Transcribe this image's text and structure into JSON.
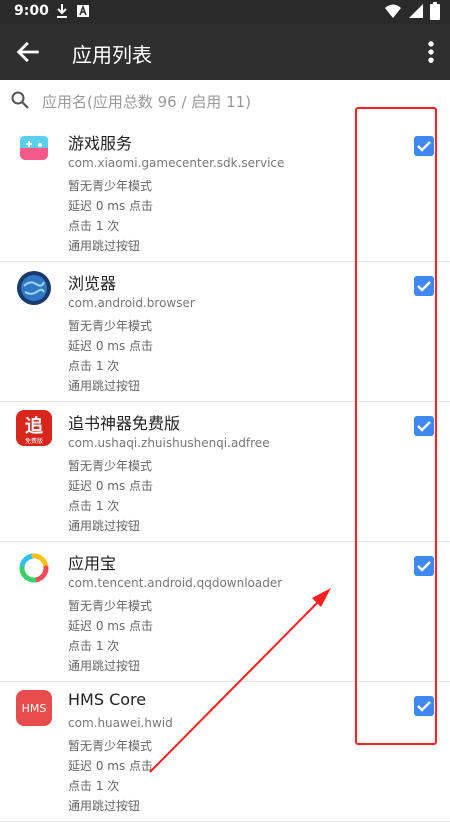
{
  "status_bar": {
    "time": "9:00",
    "icons": [
      "download-icon",
      "a-notification-icon",
      "wifi-icon",
      "signal-icon",
      "battery-icon"
    ]
  },
  "app_bar": {
    "title": "应用列表",
    "back_icon": "arrow-left-icon",
    "menu_icon": "more-vertical-icon"
  },
  "search": {
    "placeholder": "应用名(应用总数 96 / 启用 11)"
  },
  "colors": {
    "checkbox": "#3f88f0",
    "annotation": "#ff1f1f"
  },
  "apps": [
    {
      "name": "游戏服务",
      "package": "com.xiaomi.gamecenter.sdk.service",
      "teen_mode": "暂无青少年模式",
      "delay": "延迟 0 ms 点击",
      "clicks": "点击 1 次",
      "skip": "通用跳过按钮",
      "checked": true
    },
    {
      "name": "浏览器",
      "package": "com.android.browser",
      "teen_mode": "暂无青少年模式",
      "delay": "延迟 0 ms 点击",
      "clicks": "点击 1 次",
      "skip": "通用跳过按钮",
      "checked": true
    },
    {
      "name": "追书神器免费版",
      "package": "com.ushaqi.zhuishushenqi.adfree",
      "teen_mode": "暂无青少年模式",
      "delay": "延迟 0 ms 点击",
      "clicks": "点击 1 次",
      "skip": "通用跳过按钮",
      "checked": true,
      "icon_text": "追",
      "icon_subtext": "免费版"
    },
    {
      "name": "应用宝",
      "package": "com.tencent.android.qqdownloader",
      "teen_mode": "暂无青少年模式",
      "delay": "延迟 0 ms 点击",
      "clicks": "点击 1 次",
      "skip": "通用跳过按钮",
      "checked": true
    },
    {
      "name": "HMS Core",
      "package": "com.huawei.hwid",
      "teen_mode": "暂无青少年模式",
      "delay": "延迟 0 ms 点击",
      "clicks": "点击 1 次",
      "skip": "通用跳过按钮",
      "checked": true,
      "icon_text": "HMS"
    }
  ]
}
